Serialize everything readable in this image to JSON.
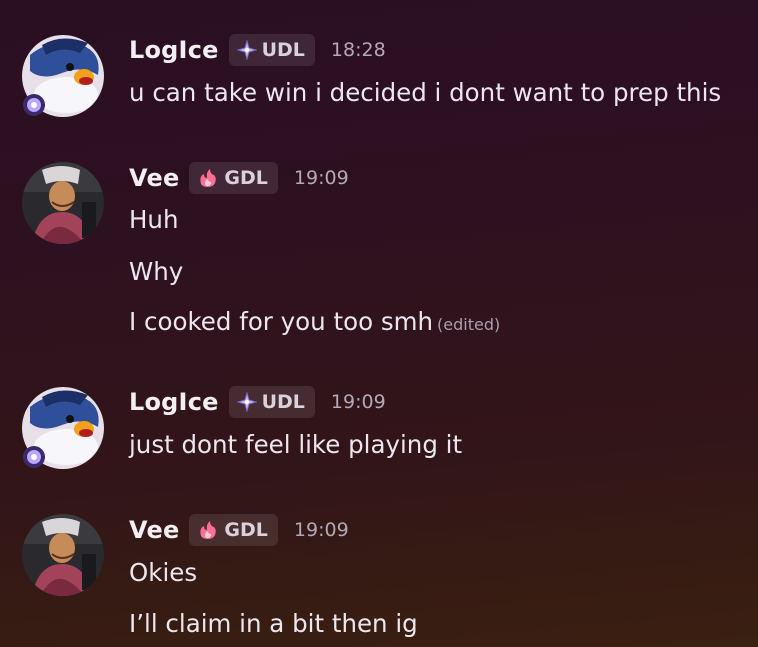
{
  "messages": [
    {
      "author": "LogIce",
      "tag": "UDL",
      "tag_icon": "diamond-sparkle-icon",
      "time": "18:28",
      "lines": [
        "u can take win i decided i dont want to prep this"
      ]
    },
    {
      "author": "Vee",
      "tag": "GDL",
      "tag_icon": "pink-flame-icon",
      "time": "19:09",
      "lines": [
        "Huh",
        "Why",
        "I cooked for you too smh"
      ],
      "edited_label": "(edited)"
    },
    {
      "author": "LogIce",
      "tag": "UDL",
      "tag_icon": "diamond-sparkle-icon",
      "time": "19:09",
      "lines": [
        "just dont feel like playing it"
      ]
    },
    {
      "author": "Vee",
      "tag": "GDL",
      "tag_icon": "pink-flame-icon",
      "time": "19:09",
      "lines": [
        "Okies",
        "I’ll claim in a bit then ig"
      ]
    }
  ],
  "colors": {
    "background_top": "#2a0e22",
    "background_bottom": "#3a2010",
    "text": "#ece6ee",
    "muted": "#b3a8b6"
  }
}
